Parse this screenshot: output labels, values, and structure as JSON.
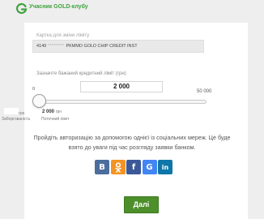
{
  "header": {
    "title": "Учасник GOLD-клубу"
  },
  "card": {
    "label": "Картка для зміни ліміту",
    "number_prefix": "4149",
    "number_mask": "********",
    "name": "PKMMD GOLD CHIP CREDIT INST"
  },
  "limit": {
    "label": "Зазначте бажаний кредитний ліміт (грн)",
    "min": "0",
    "max": "50 000",
    "value": "2 000",
    "slider_fraction": 0.04
  },
  "debt": {
    "unit": "грн",
    "label": "Заборгованість"
  },
  "current": {
    "value": "2 000",
    "unit": "грн",
    "label": "Поточний ліміт"
  },
  "social": {
    "text": "Пройдіть авторизацію за допомогою однієї із соціальних мереж. Це буде взято до уваги під час розгляду заявки банком.",
    "buttons": [
      {
        "name": "vk",
        "glyph": "B"
      },
      {
        "name": "ok",
        "glyph": "ok"
      },
      {
        "name": "facebook",
        "glyph": "f"
      },
      {
        "name": "google",
        "glyph": "G"
      },
      {
        "name": "linkedin",
        "glyph": "in"
      }
    ]
  },
  "next_label": "Далі",
  "colors": {
    "brand_green": "#3fa33f",
    "button_green": "#4c8f2b"
  }
}
